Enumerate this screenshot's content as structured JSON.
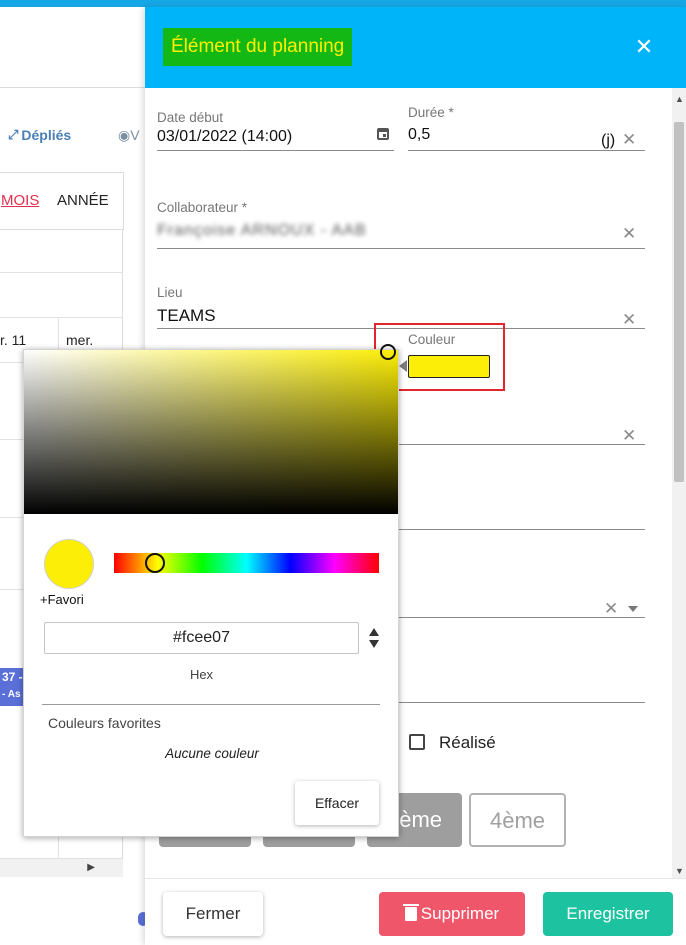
{
  "background": {
    "toolbar_depliés": "Dépliés",
    "toolbar_view_partial": "V",
    "tab_mois": "MOIS",
    "tab_annee": "ANNÉE",
    "day1": "r. 11",
    "day2": "mer.",
    "event_line1": "37 -",
    "event_line2": "- As"
  },
  "modal": {
    "title": "Élément du planning",
    "fields": {
      "date_debut": {
        "label": "Date début",
        "value": "03/01/2022 (14:00)"
      },
      "duree": {
        "label": "Durée *",
        "value": "0,5",
        "unit": "(j)"
      },
      "collaborateur": {
        "label": "Collaborateur *",
        "value": "Françoise ARNOUX - AAB"
      },
      "lieu": {
        "label": "Lieu",
        "value": "TEAMS"
      },
      "couleur": {
        "label": "Couleur",
        "value": "#fcee07"
      }
    },
    "realise_label": "Réalisé",
    "segments": [
      "3ème",
      "4ème"
    ],
    "footer": {
      "fermer": "Fermer",
      "supprimer": "Supprimer",
      "enregistrer": "Enregistrer"
    }
  },
  "color_picker": {
    "selected_hex": "#fcee07",
    "hue_fraction": 0.155,
    "favorite_link": "+Favori",
    "mode_label": "Hex",
    "favorites_title": "Couleurs favorites",
    "favorites_empty": "Aucune couleur",
    "clear_button": "Effacer"
  },
  "colors": {
    "header_bg": "#00b4fa",
    "title_bg": "#14b814",
    "title_fg": "#ffee00",
    "danger": "#f0566a",
    "success": "#1dc3a0",
    "highlight_box": "#e2262e",
    "accent_link": "#e0304e"
  },
  "icons": {
    "close": "close-icon",
    "calendar": "calendar-icon",
    "clear": "clear-x-icon",
    "trash": "trash-icon",
    "dropdown": "chevron-down-icon",
    "expand": "expand-icon",
    "eye": "eye-icon"
  }
}
